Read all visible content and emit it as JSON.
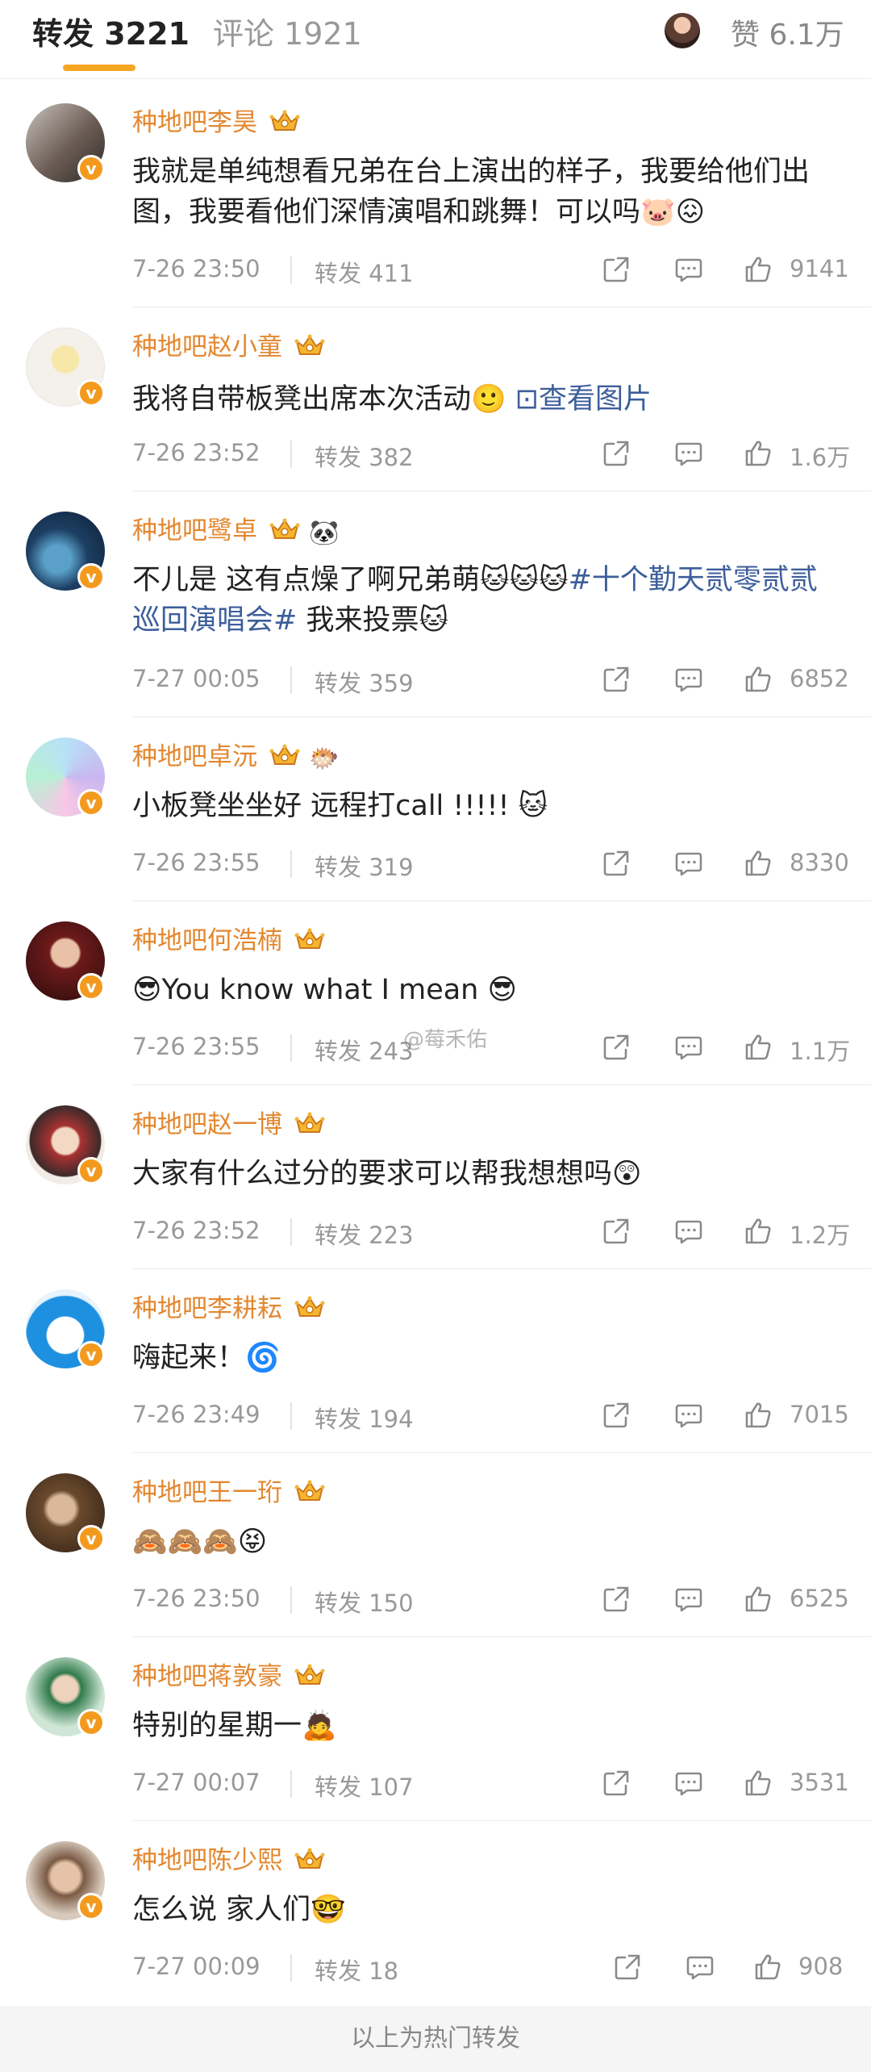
{
  "tabs": {
    "active": "转发 3221",
    "inactive": "评论 1921",
    "likes": "赞 6.1万"
  },
  "colors": {
    "accent": "#f5a623",
    "name": "#e3872f",
    "topic": "#3d5e9b"
  },
  "watermark": "@莓禾佑",
  "items": [
    {
      "name": "种地吧李昊",
      "text": "我就是单纯想看兄弟在台上演出的样子，我要给他们出图，我要看他们深情演唱和跳舞！可以吗🐷😖",
      "time": "7-26 23:50",
      "repost": "转发 411",
      "likes": "9141"
    },
    {
      "name": "种地吧赵小童",
      "text": "我将自带板凳出席本次活动🙂",
      "link": "⊡查看图片",
      "time": "7-26 23:52",
      "repost": "转发 382",
      "likes": "1.6万"
    },
    {
      "name": "种地吧鹭卓",
      "extra": "🐼",
      "text_a": "不儿是 这有点燥了啊兄弟萌🐱🐱🐱",
      "topic": "#十个勤天贰零贰贰巡回演唱会#",
      "text_b": " 我来投票🐱",
      "time": "7-27 00:05",
      "repost": "转发 359",
      "likes": "6852"
    },
    {
      "name": "种地吧卓沅",
      "extra": "🐡",
      "text": "小板凳坐坐好 远程打call !!!!!  🐱",
      "time": "7-26 23:55",
      "repost": "转发 319",
      "likes": "8330"
    },
    {
      "name": "种地吧何浩楠",
      "text": "😎You know what I mean 😎",
      "time": "7-26 23:55",
      "repost": "转发 243",
      "likes": "1.1万"
    },
    {
      "name": "种地吧赵一博",
      "text": "大家有什么过分的要求可以帮我想想吗😲",
      "time": "7-26 23:52",
      "repost": "转发 223",
      "likes": "1.2万"
    },
    {
      "name": "种地吧李耕耘",
      "text": "嗨起来！🌀",
      "time": "7-26 23:49",
      "repost": "转发 194",
      "likes": "7015"
    },
    {
      "name": "种地吧王一珩",
      "text": "🙈🙈🙈😝",
      "time": "7-26 23:50",
      "repost": "转发 150",
      "likes": "6525"
    },
    {
      "name": "种地吧蒋敦豪",
      "text": "特别的星期一🙇",
      "time": "7-27 00:07",
      "repost": "转发 107",
      "likes": "3531"
    },
    {
      "name": "种地吧陈少熙",
      "text": "怎么说 家人们🤓",
      "time": "7-27 00:09",
      "repost": "转发 18",
      "likes": "908"
    }
  ],
  "footer": "以上为热门转发"
}
